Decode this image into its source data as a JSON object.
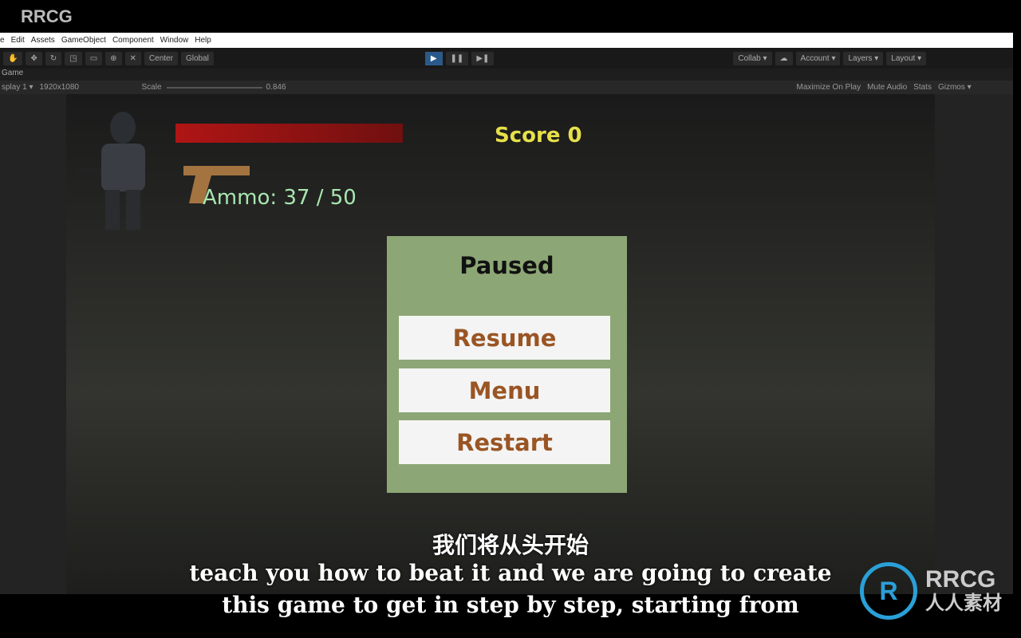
{
  "watermark": "RRCG",
  "menu": [
    "e",
    "Edit",
    "Assets",
    "GameObject",
    "Component",
    "Window",
    "Help"
  ],
  "toolbar": {
    "center": "Center",
    "global": "Global",
    "collab": "Collab ▾",
    "account": "Account ▾",
    "layers": "Layers ▾",
    "layout": "Layout ▾",
    "play": "▶",
    "pause": "❚❚",
    "step": "▶❚"
  },
  "tab": "Game",
  "gamebar": {
    "display": "splay 1 ▾",
    "resolution": "1920x1080",
    "scale_label": "Scale",
    "scale_value": "0.846",
    "maximize": "Maximize On Play",
    "mute": "Mute Audio",
    "stats": "Stats",
    "gizmos": "Gizmos ▾"
  },
  "hud": {
    "health_fraction": 0.75,
    "score": "Score 0",
    "ammo": "Ammo: 37 / 50"
  },
  "pause": {
    "title": "Paused",
    "resume": "Resume",
    "menu": "Menu",
    "restart": "Restart"
  },
  "subtitles": {
    "chinese": "我们将从头开始",
    "line1": "teach you how to beat it and we are going to create",
    "line2": "this game to get in step by step, starting from"
  },
  "logo": {
    "mark": "R",
    "text1": "RRCG",
    "text2": "人人素材"
  }
}
